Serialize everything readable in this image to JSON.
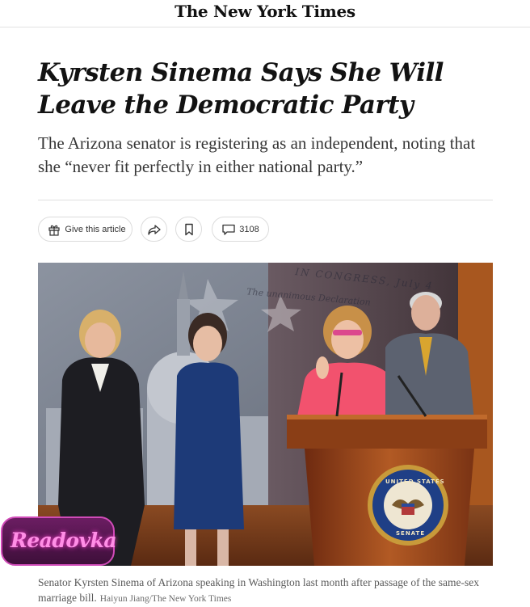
{
  "masthead": {
    "logo_text": "The New York Times"
  },
  "article": {
    "headline": "Kyrsten Sinema Says She Will Leave the Democratic Party",
    "summary": "The Arizona senator is registering as an independent, noting that she “never fit perfectly in either national party.”"
  },
  "toolbar": {
    "gift_label": "Give this article",
    "share_icon": "share-icon",
    "bookmark_icon": "bookmark-icon",
    "comment_count": "3108"
  },
  "photo": {
    "backdrop_text_1": "IN CONGRESS, July 4",
    "backdrop_text_2": "The unanimous Declaration",
    "seal_top": "UNITED STATES",
    "seal_bottom": "SENATE"
  },
  "watermark": {
    "text": "Readovka"
  },
  "caption": {
    "text": "Senator Kyrsten Sinema of Arizona speaking in Washington last month after passage of the same-sex marriage bill.",
    "credit": "Haiyun Jiang/The New York Times"
  },
  "colors": {
    "text": "#121212",
    "summary": "#363636",
    "caption": "#5a5a5a",
    "rule": "#dfdfdf",
    "badge": "#d04bb8"
  }
}
